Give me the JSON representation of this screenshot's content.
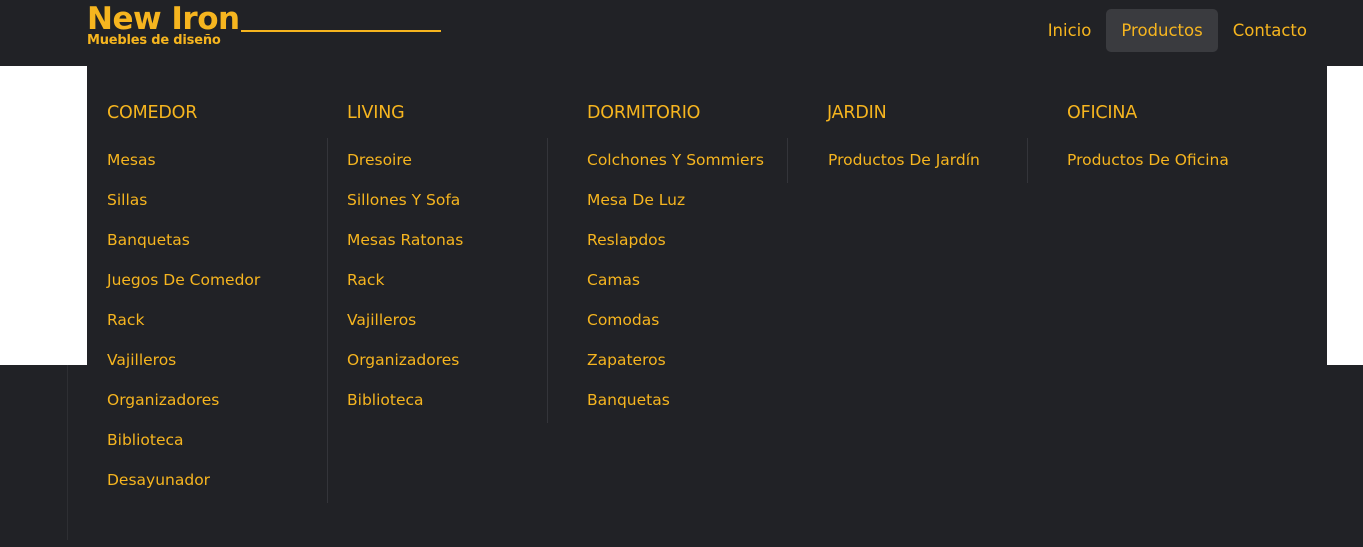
{
  "brand": {
    "name": "New Iron",
    "tagline": "Muebles de diseño"
  },
  "nav": {
    "items": [
      {
        "label": "Inicio"
      },
      {
        "label": "Productos"
      },
      {
        "label": "Contacto"
      }
    ]
  },
  "menu": {
    "columns": [
      {
        "heading": "COMEDOR",
        "items": [
          "Mesas",
          "Sillas",
          "Banquetas",
          "Juegos De Comedor",
          "Rack",
          "Vajilleros",
          "Organizadores",
          "Biblioteca",
          "Desayunador"
        ]
      },
      {
        "heading": "LIVING",
        "items": [
          "Dresoire",
          "Sillones Y Sofa",
          "Mesas Ratonas",
          "Rack",
          "Vajilleros",
          "Organizadores",
          "Biblioteca"
        ]
      },
      {
        "heading": "DORMITORIO",
        "items": [
          "Colchones Y Sommiers",
          "Mesa De Luz",
          "Reslapdos",
          "Camas",
          "Comodas",
          "Zapateros",
          "Banquetas"
        ]
      },
      {
        "heading": "JARDIN",
        "items": [
          "Productos De Jardín"
        ]
      },
      {
        "heading": "OFICINA",
        "items": [
          "Productos De Oficina"
        ]
      }
    ]
  },
  "colors": {
    "accent": "#f6b51f",
    "background": "#212226",
    "active_nav_bg": "#3a3b3f"
  }
}
